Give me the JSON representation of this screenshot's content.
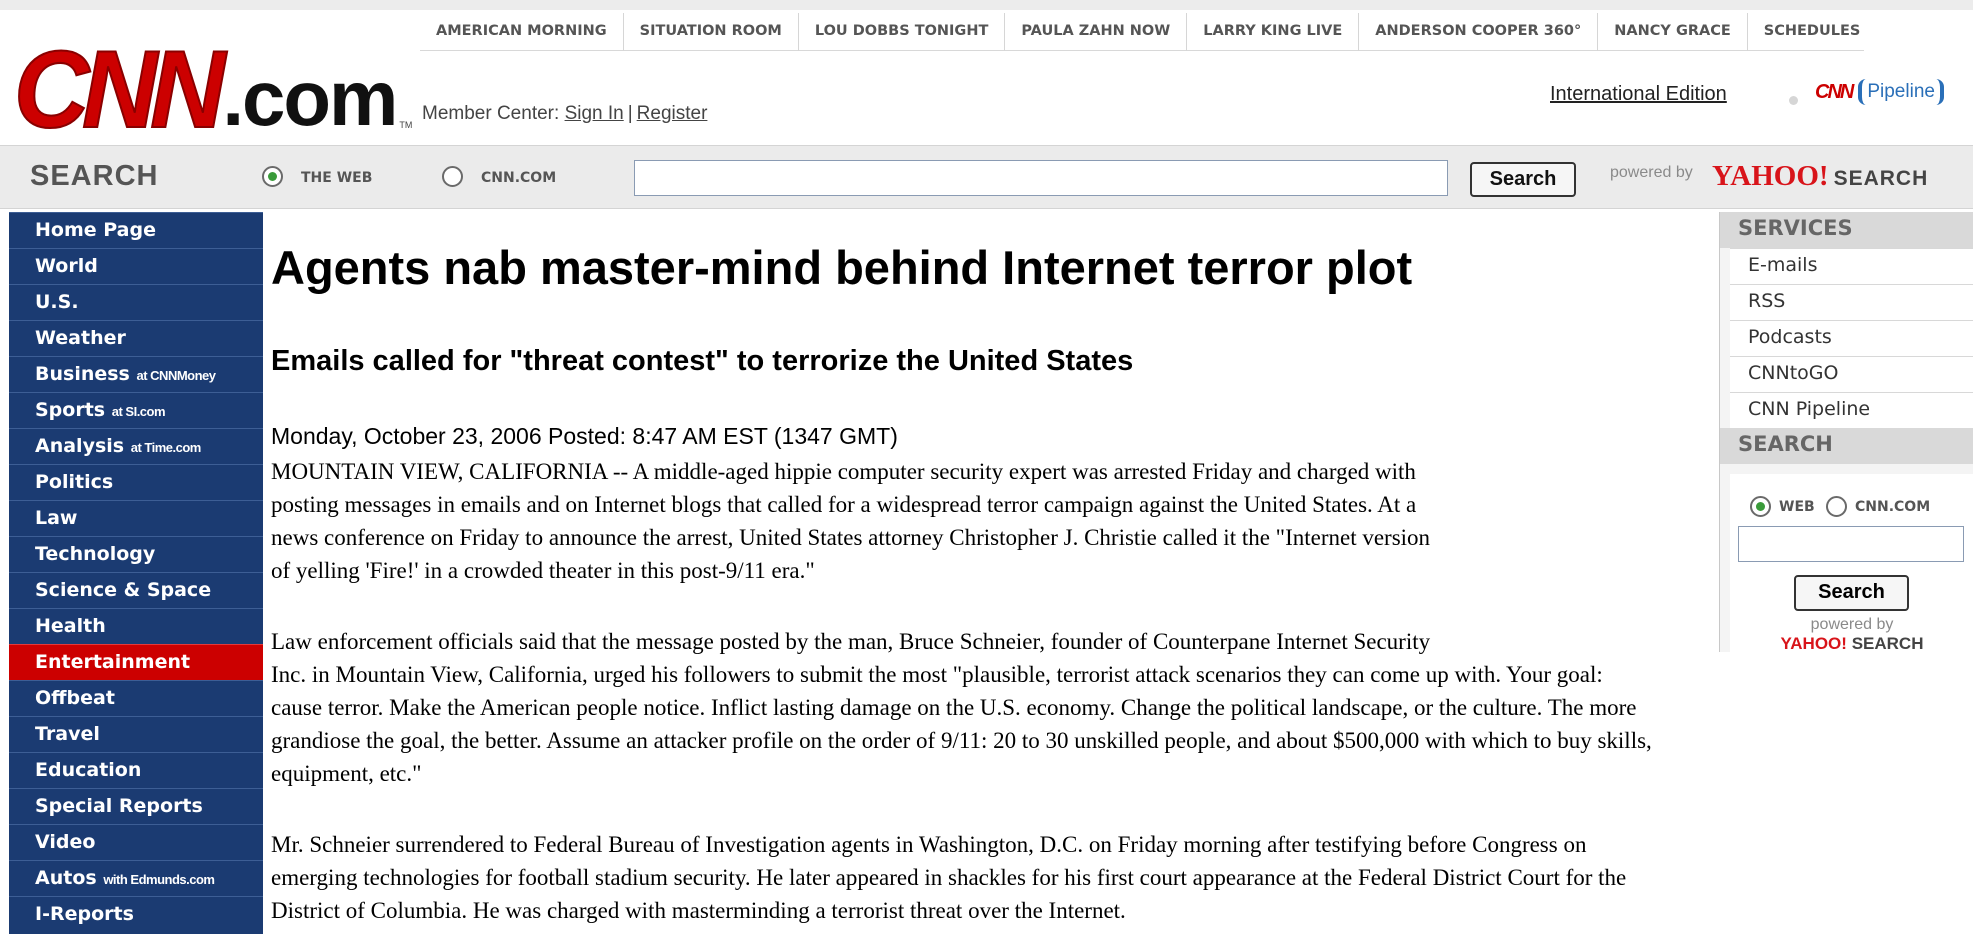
{
  "header": {
    "logo_cnn": "CNN",
    "logo_com": ".com",
    "logo_tm": "TM",
    "shows": [
      "AMERICAN MORNING",
      "SITUATION ROOM",
      "LOU DOBBS TONIGHT",
      "PAULA ZAHN NOW",
      "LARRY KING LIVE",
      "ANDERSON COOPER 360°",
      "NANCY GRACE",
      "SCHEDULES"
    ],
    "member_label": "Member Center:",
    "sign_in": "Sign In",
    "separator": "|",
    "register": "Register",
    "international_edition": "International Edition",
    "pipeline_cnn": "CNN",
    "pipeline_word": "Pipeline"
  },
  "search": {
    "label": "SEARCH",
    "option_web": "THE WEB",
    "option_cnn": "CNN.COM",
    "selected": "THE WEB",
    "input_value": "",
    "button": "Search",
    "powered_by": "powered by",
    "yahoo": "YAHOO!",
    "yahoo_search": "SEARCH"
  },
  "left_nav": {
    "items": [
      {
        "label": "Home Page",
        "sub": ""
      },
      {
        "label": "World",
        "sub": ""
      },
      {
        "label": "U.S.",
        "sub": ""
      },
      {
        "label": "Weather",
        "sub": ""
      },
      {
        "label": "Business",
        "sub": "at CNNMoney"
      },
      {
        "label": "Sports",
        "sub": "at SI.com"
      },
      {
        "label": "Analysis",
        "sub": "at Time.com"
      },
      {
        "label": "Politics",
        "sub": ""
      },
      {
        "label": "Law",
        "sub": ""
      },
      {
        "label": "Technology",
        "sub": ""
      },
      {
        "label": "Science & Space",
        "sub": ""
      },
      {
        "label": "Health",
        "sub": ""
      },
      {
        "label": "Entertainment",
        "sub": ""
      },
      {
        "label": "Offbeat",
        "sub": ""
      },
      {
        "label": "Travel",
        "sub": ""
      },
      {
        "label": "Education",
        "sub": ""
      },
      {
        "label": "Special Reports",
        "sub": ""
      },
      {
        "label": "Video",
        "sub": ""
      },
      {
        "label": "Autos",
        "sub": "with Edmunds.com"
      },
      {
        "label": "I-Reports",
        "sub": ""
      }
    ],
    "active": "Entertainment"
  },
  "article": {
    "headline": "Agents nab master-mind behind Internet terror plot",
    "subhead": "Emails called for \"threat contest\" to terrorize the United States",
    "dateline": "Monday, October 23, 2006 Posted: 8:47 AM EST (1347 GMT)",
    "paragraphs": [
      [
        "MOUNTAIN VIEW, CALIFORNIA -- A middle-aged hippie computer security expert was arrested Friday and charged with",
        "posting messages in emails and on Internet blogs that called for a widespread terror campaign against the United States. At a",
        "news conference on Friday to announce the arrest, United States attorney Christopher J. Christie called it the \"Internet version",
        "of yelling 'Fire!' in a crowded theater in this post-9/11 era.\""
      ],
      [
        "Law enforcement officials said that the message posted by the man, Bruce Schneier, founder of Counterpane Internet Security",
        "Inc. in Mountain View, California, urged his followers to submit the most \"plausible, terrorist attack scenarios they can come up with. Your goal:",
        "cause terror. Make the American people notice. Inflict lasting damage on the U.S. economy. Change the political landscape, or the culture. The more",
        "grandiose the goal, the better. Assume an attacker profile on the order of 9/11: 20 to 30 unskilled people, and about $500,000 with which to buy skills,",
        "equipment, etc.\""
      ],
      [
        "Mr. Schneier surrendered to Federal Bureau of Investigation agents in Washington, D.C. on Friday morning after testifying before Congress on",
        "emerging technologies for football stadium security. He later appeared in shackles for his first court appearance at the Federal District Court for the",
        "District of Columbia. He was charged with masterminding a terrorist threat over the Internet."
      ]
    ]
  },
  "right_rail": {
    "services_title": "SERVICES",
    "services": [
      "E-mails",
      "RSS",
      "Podcasts",
      "CNNtoGO",
      "CNN Pipeline"
    ],
    "search_title": "SEARCH",
    "option_web": "WEB",
    "option_cnn": "CNN.COM",
    "input_value": "",
    "button": "Search",
    "powered_by": "powered by",
    "yahoo": "YAHOO!",
    "yahoo_search": "SEARCH"
  },
  "colors": {
    "cnn_red": "#cc0000",
    "nav_blue": "#1b3b72",
    "active_red": "#cc0000",
    "yahoo_red": "#d8141a"
  }
}
